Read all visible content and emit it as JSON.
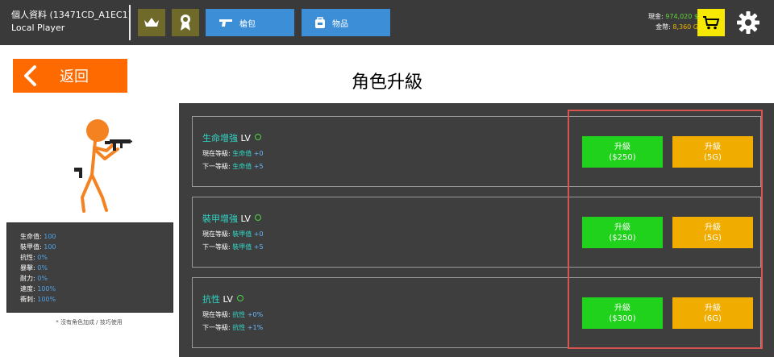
{
  "header": {
    "profile_name": "個人資料 (13471CD_A1EC1)",
    "player": "Local Player",
    "tabs": [
      {
        "label": "槍包",
        "icon": "pistol-icon"
      },
      {
        "label": "物品",
        "icon": "backpack-icon"
      }
    ],
    "cash_label": "現金:",
    "cash_value": "974,020 $",
    "gold_label": "金幣:",
    "gold_value": "8,360 G"
  },
  "back_label": "返回",
  "page_title": "角色升級",
  "stats": [
    {
      "label": "生命值: ",
      "value": "100"
    },
    {
      "label": "裝甲值: ",
      "value": "100"
    },
    {
      "label": "抗性: ",
      "value": "0%"
    },
    {
      "label": "暴擊: ",
      "value": "0%"
    },
    {
      "label": "耐力: ",
      "value": "0%"
    },
    {
      "label": "速度: ",
      "value": "100%"
    },
    {
      "label": "衝刺: ",
      "value": "100%"
    }
  ],
  "note": "* 沒有角色加成 / 技巧使用",
  "upgrades": [
    {
      "name": "生命增強",
      "lv": "LV",
      "current_label": "現在等級: ",
      "current_stat": "生命值",
      "current_value": "+0",
      "next_label": "下一等級: ",
      "next_stat": "生命值",
      "next_value": "+5",
      "cash_btn_line1": "升級",
      "cash_btn_line2": "($250)",
      "gold_btn_line1": "升級",
      "gold_btn_line2": "(5G)"
    },
    {
      "name": "裝甲增強",
      "lv": "LV",
      "current_label": "現在等級: ",
      "current_stat": "裝甲值",
      "current_value": "+0",
      "next_label": "下一等級: ",
      "next_stat": "裝甲值",
      "next_value": "+5",
      "cash_btn_line1": "升級",
      "cash_btn_line2": "($250)",
      "gold_btn_line1": "升級",
      "gold_btn_line2": "(5G)"
    },
    {
      "name": "抗性",
      "lv": "LV",
      "current_label": "現在等級: ",
      "current_stat": "抗性",
      "current_value": "+0%",
      "next_label": "下一等級: ",
      "next_stat": "抗性",
      "next_value": "+1%",
      "cash_btn_line1": "升級",
      "cash_btn_line2": "($300)",
      "gold_btn_line1": "升級",
      "gold_btn_line2": "(6G)"
    }
  ],
  "colors": {
    "header_bg": "#3a3a3a",
    "tab_blue": "#3c8ed6",
    "back_orange": "#ff6a00",
    "upgrade_green": "#20d21c",
    "upgrade_gold": "#f0ad00",
    "cash_green": "#5ed635",
    "gold_yellow": "#f0b400",
    "highlight_red": "#d9534f"
  }
}
